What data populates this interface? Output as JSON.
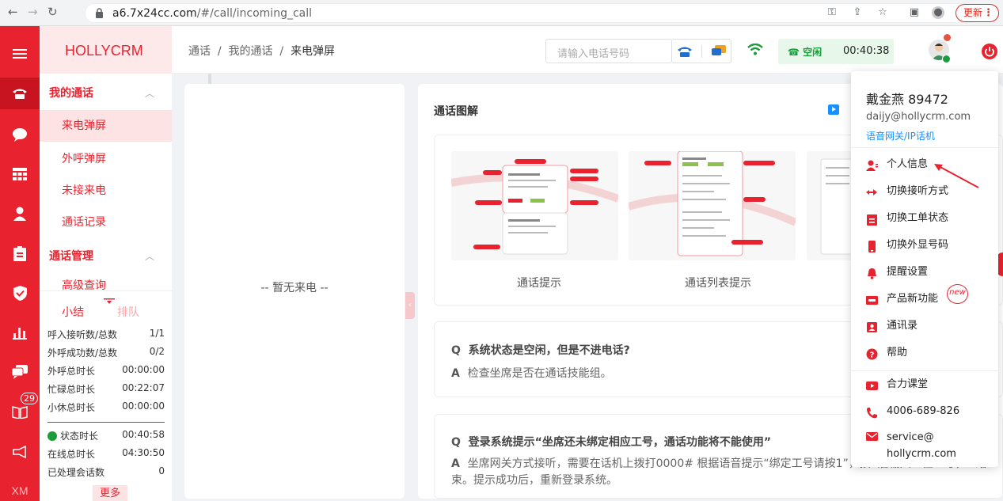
{
  "browser": {
    "url_host": "a6.7x24cc.com",
    "url_path": "/#/call/incoming_call",
    "update_label": "更新"
  },
  "sidebar": {
    "brand": "HOLLYCRM",
    "groups": [
      {
        "label": "我的通话",
        "items": [
          "来电弹屏",
          "外呼弹屏",
          "未接来电",
          "通话记录"
        ]
      },
      {
        "label": "通话管理",
        "items": [
          "高级查询"
        ]
      }
    ],
    "rail_badge": "29",
    "rail_bottom": "XM"
  },
  "summary": {
    "tabs": [
      "小结",
      "排队"
    ],
    "rows": [
      {
        "label": "呼入接听数/总数",
        "value": "1/1"
      },
      {
        "label": "外呼成功数/总数",
        "value": "0/2"
      },
      {
        "label": "外呼总时长",
        "value": "00:00:00"
      },
      {
        "label": "忙碌总时长",
        "value": "00:22:07"
      },
      {
        "label": "小休总时长",
        "value": "00:00:00"
      },
      {
        "label": "状态时长",
        "value": "00:40:58"
      },
      {
        "label": "在线总时长",
        "value": "04:30:50"
      },
      {
        "label": "已处理会话数",
        "value": "0"
      }
    ],
    "more": "更多"
  },
  "header": {
    "breadcrumb": [
      "通话",
      "我的通话",
      "来电弹屏"
    ],
    "phone_placeholder": "请输入电话号码",
    "status": "空闲",
    "timer": "00:40:38"
  },
  "left_panel": {
    "empty": "-- 暂无来电 --"
  },
  "main": {
    "title": "通话图解",
    "captions": [
      "通话提示",
      "通话列表提示"
    ],
    "faqs": [
      {
        "q": "系统状态是空闲，但是不进电话?",
        "a": "检查坐席是否在通话技能组。"
      },
      {
        "q": "登录系统提示“坐席还未绑定相应工号，通话功能将不能使用”",
        "a": "坐席网关方式接听，需要在话机上拨打0000# 根据语音提示“绑定工号请按1”，按1后输入工位工号，#结束。提示成功后，重新登录系统。"
      }
    ]
  },
  "dropdown": {
    "name": "戴金燕 89472",
    "email": "daijy@hollycrm.com",
    "type": "语音网关/IP话机",
    "items": [
      "个人信息",
      "切换接听方式",
      "切换工单状态",
      "切换外显号码",
      "提醒设置",
      "产品新功能",
      "通讯录",
      "帮助"
    ],
    "links": [
      "合力课堂",
      "4006-689-826",
      "service@",
      "hollycrm.com"
    ],
    "new_badge": "new"
  },
  "colors": {
    "brand": "#e8232f",
    "status_green": "#1a9c3a",
    "link_blue": "#1890ff"
  }
}
